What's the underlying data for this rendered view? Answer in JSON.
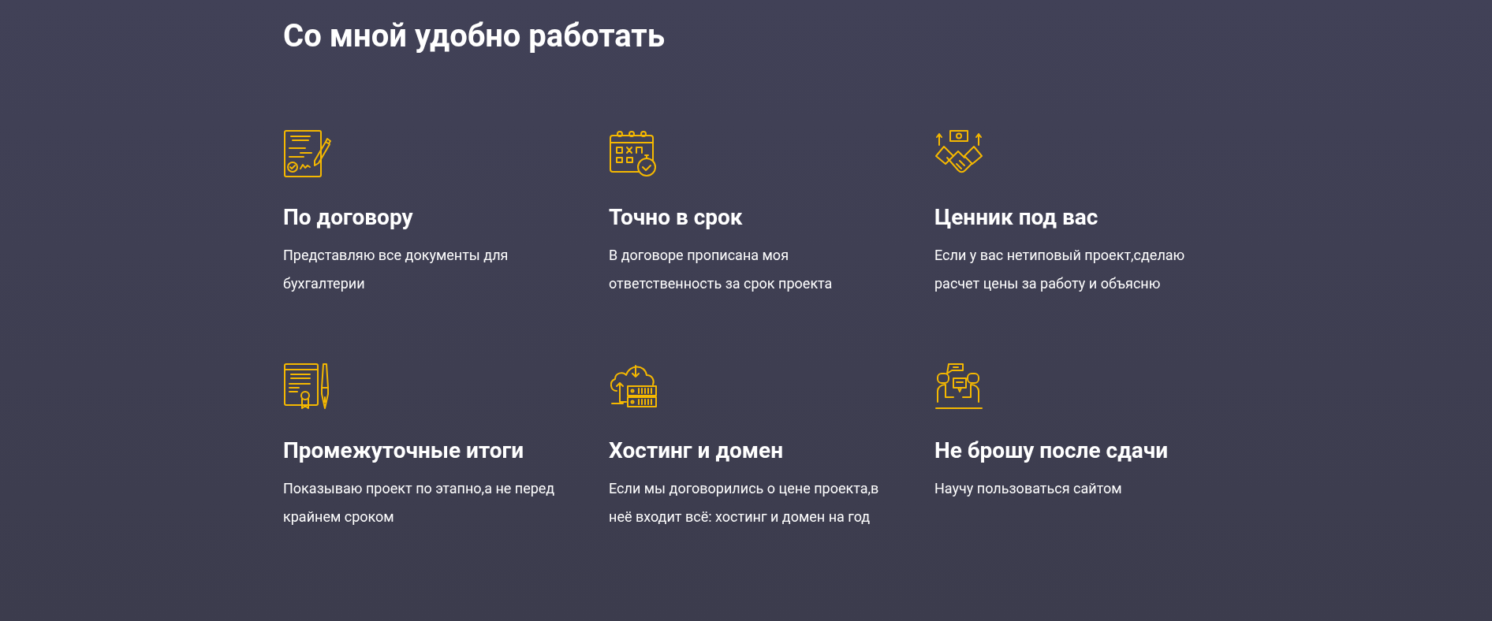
{
  "title": "Со мной удобно работать",
  "features": [
    {
      "kind": "contract",
      "heading": "По договору",
      "text": "Представляю все документы для бухгалтерии"
    },
    {
      "kind": "calendar",
      "heading": "Точно в срок",
      "text": "В договоре прописана моя ответственность за срок проекта"
    },
    {
      "kind": "handshake",
      "heading": "Ценник под вас",
      "text": "Если у вас нетиповый проект,сделаю расчет цены за работу и объясню"
    },
    {
      "kind": "certificate",
      "heading": "Промежуточные итоги",
      "text": "Показываю проект по этапно,а не перед крайнем сроком"
    },
    {
      "kind": "hosting",
      "heading": "Хостинг и домен",
      "text": "Если мы договорились о цене проекта,в неё входит всё: хостинг и домен на год"
    },
    {
      "kind": "support",
      "heading": "Не брошу после сдачи",
      "text": "Научу пользоваться сайтом"
    }
  ]
}
